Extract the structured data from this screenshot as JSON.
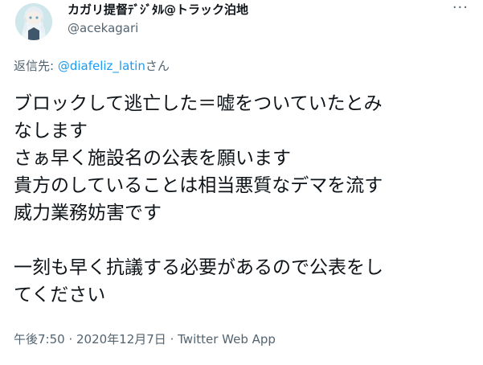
{
  "author": {
    "display_name": "カガリ提督ﾃﾞｼﾞﾀﾙ@トラック泊地",
    "handle": "@acekagari",
    "avatar_icon": "anime-character-avatar"
  },
  "more_icon": "more-options-icon",
  "reply": {
    "prefix": "返信先: ",
    "mention": "@diafeliz_latin",
    "suffix": "さん"
  },
  "tweet": {
    "lines": [
      "ブロックして逃亡した＝嘘をついていたとみ",
      "なします",
      "さぁ早く施設名の公表を願います",
      "貴方のしていることは相当悪質なデマを流す",
      "威力業務妨害です",
      "",
      "一刻も早く抗議する必要があるので公表をし",
      "てください"
    ]
  },
  "meta": {
    "time": "午後7:50",
    "separator": " · ",
    "date": "2020年12月7日",
    "app": "Twitter Web App"
  },
  "colors": {
    "text": "#0f1419",
    "secondary": "#536471",
    "link": "#1d9bf0"
  }
}
